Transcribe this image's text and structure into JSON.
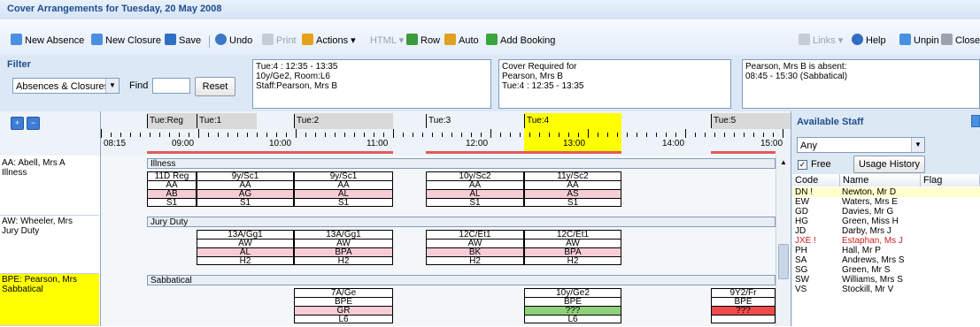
{
  "window": {
    "title": "Cover Arrangements for Tuesday, 20 May 2008"
  },
  "toolbar": {
    "new_absence": "New Absence",
    "new_closure": "New Closure",
    "save": "Save",
    "undo": "Undo",
    "print": "Print",
    "actions": "Actions",
    "html": "HTML",
    "row": "Row",
    "auto": "Auto",
    "add_booking": "Add Booking",
    "links": "Links",
    "help": "Help",
    "unpin": "Unpin",
    "close": "Close"
  },
  "filter": {
    "title": "Filter",
    "type_value": "Absences & Closures",
    "find_label": "Find",
    "find_value": "",
    "reset": "Reset"
  },
  "info_boxes": {
    "lesson": [
      "Tue:4 : 12:35 - 13:35",
      "10y/Ge2, Room:L6",
      "Staff:Pearson, Mrs B"
    ],
    "cover": [
      "Cover Required for",
      "Pearson, Mrs B",
      "Tue:4 : 12:35 - 13:35"
    ],
    "absence": [
      "Pearson, Mrs B is absent:",
      "08:45 - 15:30 (Sabbatical)"
    ]
  },
  "timeline": {
    "periods": [
      "Tue:Reg",
      "Tue:1",
      "Tue:2",
      "Tue:3",
      "Tue:4",
      "Tue:5"
    ],
    "times": [
      "08:15",
      "09:00",
      "10:00",
      "11:00",
      "12:00",
      "13:00",
      "14:00",
      "15:00"
    ]
  },
  "staff": [
    {
      "name": "AA: Abell, Mrs A",
      "reason": "Illness",
      "band": "Illness"
    },
    {
      "name": "AW: Wheeler, Mrs",
      "reason": "Jury Duty",
      "band": "Jury Duty"
    },
    {
      "name": "BPE: Pearson, Mrs",
      "reason": "Sabbatical",
      "band": "Sabbatical"
    }
  ],
  "lessons": {
    "aa": [
      [
        "11D Reg",
        "AA",
        "AB",
        "S1"
      ],
      [
        "9y/Sc1",
        "AA",
        "AG",
        "S1"
      ],
      [
        "9y/Sc1",
        "AA",
        "AL",
        "S1"
      ],
      [
        "10y/Sc2",
        "AA",
        "AL",
        "S1"
      ],
      [
        "11y/Sc2",
        "AA",
        "AS",
        "S1"
      ]
    ],
    "aw": [
      [
        "13A/Gg1",
        "AW",
        "AL",
        "H2"
      ],
      [
        "13A/Gg1",
        "AW",
        "BPA",
        "H2"
      ],
      [
        "12C/Et1",
        "AW",
        "BK",
        "H2"
      ],
      [
        "12C/Et1",
        "AW",
        "BPA",
        "H2"
      ]
    ],
    "bpe": [
      [
        "7A/Ge",
        "BPE",
        "GR",
        "L6"
      ],
      [
        "10y/Ge2",
        "BPE",
        "???",
        "L6"
      ],
      [
        "9Y2/Fr",
        "BPE",
        "???",
        ""
      ]
    ]
  },
  "available_staff": {
    "title": "Available Staff",
    "filter_value": "Any",
    "free_label": "Free",
    "usage_history": "Usage History",
    "columns": [
      "Code",
      "Name",
      "Flag"
    ],
    "rows": [
      {
        "code": "DN !",
        "name": "Newton, Mr D"
      },
      {
        "code": "EW",
        "name": "Waters, Mrs E"
      },
      {
        "code": "GD",
        "name": "Davies, Mr G"
      },
      {
        "code": "HG",
        "name": "Green, Miss H"
      },
      {
        "code": "JD",
        "name": "Darby, Mrs J"
      },
      {
        "code": "JXE !",
        "name": "Estaphan, Ms J"
      },
      {
        "code": "PH",
        "name": "Hall, Mr P"
      },
      {
        "code": "SA",
        "name": "Andrews, Mrs S"
      },
      {
        "code": "SG",
        "name": "Green, Mr S"
      },
      {
        "code": "SW",
        "name": "Williams, Mrs S"
      },
      {
        "code": "VS",
        "name": "Stockill, Mr V"
      }
    ]
  },
  "colors": {
    "highlight": "#ffff00",
    "danger_text": "#d42020",
    "accent": "#1f4d8c"
  }
}
